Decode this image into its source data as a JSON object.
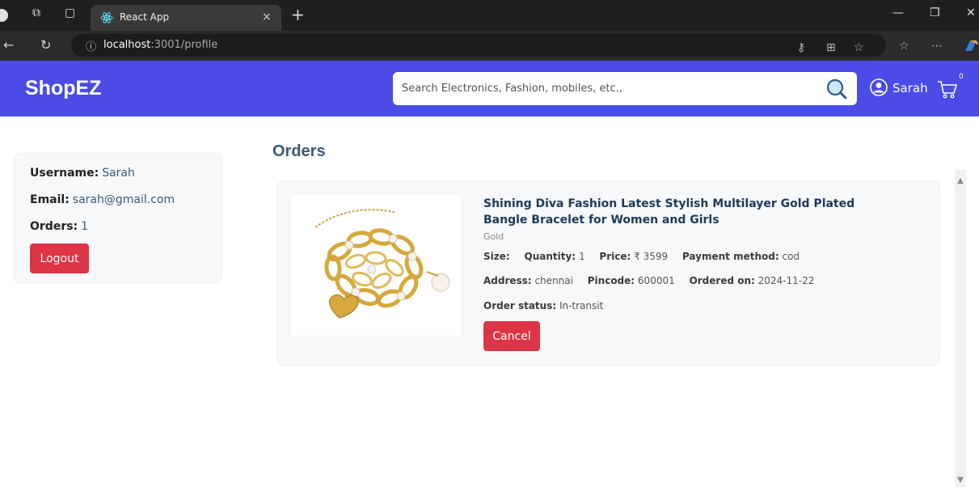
{
  "browser": {
    "tab_title": "React App",
    "tab_close": "×",
    "new_tab": "+",
    "url_host": "localhost",
    "url_path": ":3001/profile"
  },
  "header": {
    "brand": "ShopEZ",
    "search_placeholder": "Search Electronics, Fashion, mobiles, etc.,",
    "user_name": "Sarah",
    "cart_count": "0",
    "accent_color": "#4b4be6"
  },
  "profile": {
    "username_label": "Username:",
    "username": "Sarah",
    "email_label": "Email:",
    "email": "sarah@gmail.com",
    "orders_label": "Orders:",
    "orders_count": "1",
    "logout_label": "Logout"
  },
  "orders": {
    "title": "Orders",
    "items": [
      {
        "title": "Shining Diva Fashion Latest Stylish Multilayer Gold Plated Bangle Bracelet for Women and Girls",
        "description": "Gold",
        "size_label": "Size:",
        "size": "",
        "quantity_label": "Quantity:",
        "quantity": "1",
        "price_label": "Price:",
        "price": "₹ 3599",
        "payment_label": "Payment method:",
        "payment": "cod",
        "address_label": "Address:",
        "address": "chennai",
        "pincode_label": "Pincode:",
        "pincode": "600001",
        "ordered_label": "Ordered on:",
        "ordered_on": "2024-11-22",
        "status_label": "Order status:",
        "status": "In-transit",
        "cancel_label": "Cancel",
        "image_icon": "gold-bracelet-image"
      }
    ]
  },
  "colors": {
    "danger": "#dc3545",
    "heading": "#3d5a73"
  }
}
